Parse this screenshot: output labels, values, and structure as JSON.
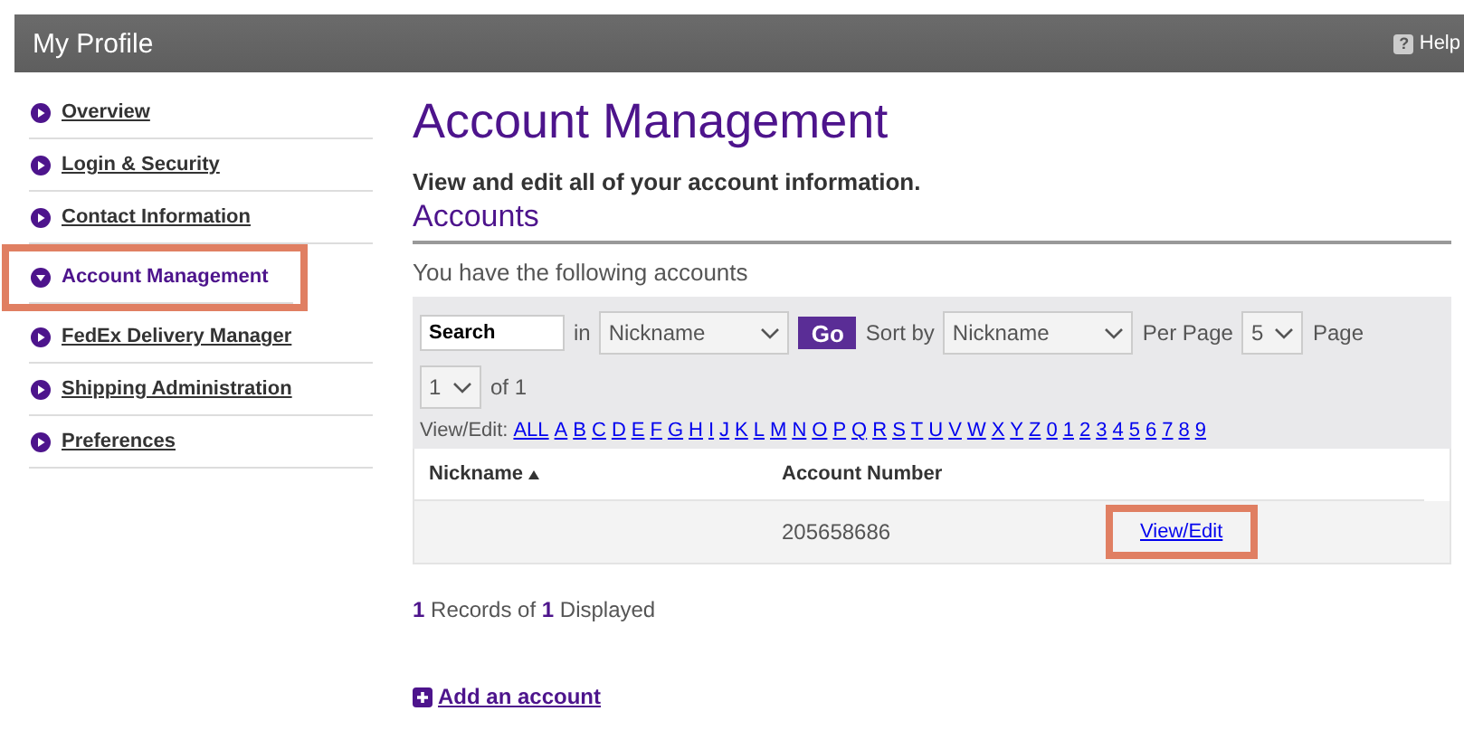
{
  "header": {
    "title": "My Profile",
    "help_icon": "?",
    "help": "Help"
  },
  "sidebar": {
    "items": [
      {
        "label": "Overview",
        "selected": false,
        "highlighted": false
      },
      {
        "label": "Login & Security",
        "selected": false,
        "highlighted": false
      },
      {
        "label": "Contact Information",
        "selected": false,
        "highlighted": false
      },
      {
        "label": "Account Management",
        "selected": true,
        "highlighted": true
      },
      {
        "label": "FedEx Delivery Manager",
        "selected": false,
        "highlighted": false
      },
      {
        "label": "Shipping Administration",
        "selected": false,
        "highlighted": false
      },
      {
        "label": "Preferences",
        "selected": false,
        "highlighted": false
      }
    ]
  },
  "main": {
    "title": "Account Management",
    "subtitle": "View and edit all of your account information.",
    "section": "Accounts",
    "intro": "You have the following accounts",
    "filters": {
      "search": {
        "value": "Search"
      },
      "in_label": "in",
      "in_select": "Nickname",
      "go": "Go",
      "sort_label": "Sort by",
      "sort_select": "Nickname",
      "per_page_label": "Per Page",
      "per_page": "5",
      "page_label": "Page",
      "page": "1",
      "of": "of 1"
    },
    "letters": {
      "label": "View/Edit:",
      "links": [
        "ALL",
        "A",
        "B",
        "C",
        "D",
        "E",
        "F",
        "G",
        "H",
        "I",
        "J",
        "K",
        "L",
        "M",
        "N",
        "O",
        "P",
        "Q",
        "R",
        "S",
        "T",
        "U",
        "V",
        "W",
        "X",
        "Y",
        "Z",
        "0",
        "1",
        "2",
        "3",
        "4",
        "5",
        "6",
        "7",
        "8",
        "9"
      ]
    },
    "table": {
      "columns": [
        {
          "label": "Nickname",
          "sorted": true
        },
        {
          "label": "Account Number",
          "sorted": false
        }
      ],
      "rows": [
        {
          "account_number": "205658686",
          "action": "View/Edit",
          "highlighted": true
        }
      ]
    },
    "records": "**1** Records of **1** Displayed",
    "add_link": "Add an account"
  }
}
